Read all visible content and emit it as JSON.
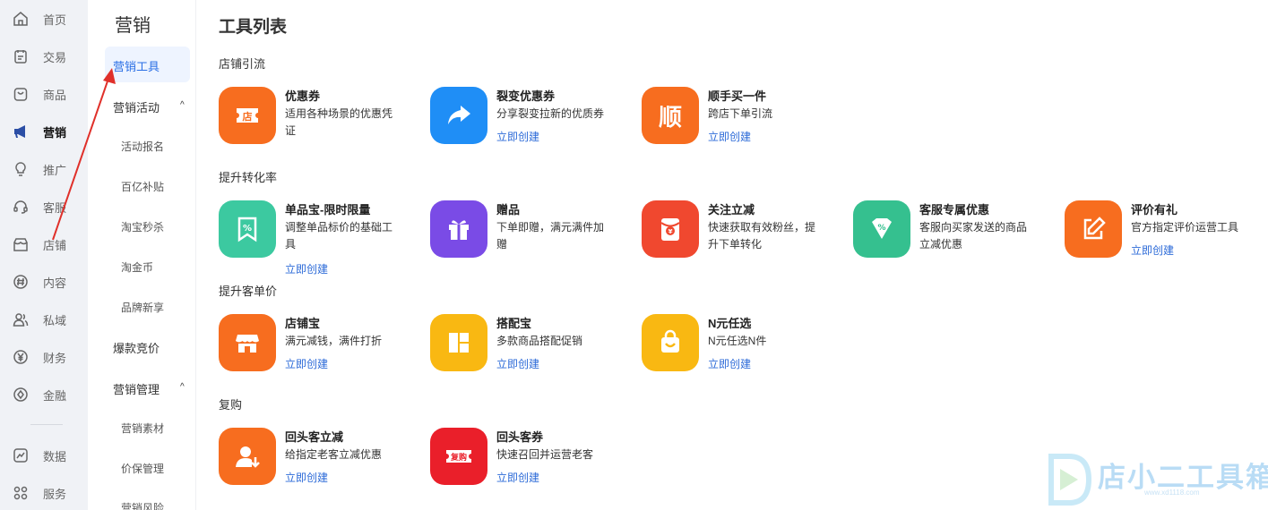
{
  "nav": {
    "items": [
      {
        "label": "首页",
        "icon": "home-icon"
      },
      {
        "label": "交易",
        "icon": "clipboard-icon"
      },
      {
        "label": "商品",
        "icon": "bag-icon"
      },
      {
        "label": "营销",
        "icon": "megaphone-icon",
        "active": true
      },
      {
        "label": "推广",
        "icon": "bulb-icon"
      },
      {
        "label": "客服",
        "icon": "headset-icon"
      },
      {
        "label": "店铺",
        "icon": "store-icon"
      },
      {
        "label": "内容",
        "icon": "hash-icon"
      },
      {
        "label": "私域",
        "icon": "people-icon"
      },
      {
        "label": "财务",
        "icon": "yen-icon"
      },
      {
        "label": "金融",
        "icon": "compass-icon"
      },
      {
        "label": "数据",
        "icon": "chart-icon"
      },
      {
        "label": "服务",
        "icon": "grid-icon"
      }
    ]
  },
  "submenu": {
    "title": "营销",
    "active_item": "营销工具",
    "group1": {
      "label": "营销活动",
      "children": [
        "活动报名",
        "百亿补贴",
        "淘宝秒杀",
        "淘金币",
        "品牌新享"
      ]
    },
    "standalone": "爆款竞价",
    "group2": {
      "label": "营销管理",
      "children": [
        "营销素材",
        "价保管理",
        "营销风险"
      ]
    },
    "caret": "^"
  },
  "main": {
    "title": "工具列表",
    "link_label": "立即创建",
    "sections": [
      {
        "title": "店铺引流",
        "tools": [
          {
            "name": "优惠券",
            "desc": "适用各种场景的优惠凭证",
            "link": "",
            "color": "#f76d1f",
            "icon": "store-ticket-icon",
            "glyph": "店"
          },
          {
            "name": "裂变优惠券",
            "desc": "分享裂变拉新的优质券",
            "link": "立即创建",
            "color": "#1f8ef6",
            "icon": "share-arrow-icon"
          },
          {
            "name": "顺手买一件",
            "desc": "跨店下单引流",
            "link": "立即创建",
            "color": "#f76d1f",
            "icon": "shun-glyph-icon",
            "glyph": "顺"
          }
        ]
      },
      {
        "title": "提升转化率",
        "tools": [
          {
            "name": "单品宝-限时限量",
            "desc": "调整单品标价的基础工具",
            "link": "立即创建",
            "color": "#3cc9a0",
            "icon": "percent-bookmark-icon"
          },
          {
            "name": "赠品",
            "desc": "下单即赠，满元满件加赠",
            "link": "",
            "color": "#7a4be6",
            "icon": "gift-icon"
          },
          {
            "name": "关注立减",
            "desc": "快速获取有效粉丝，提升下单转化",
            "link": "",
            "color": "#f0482f",
            "icon": "red-envelope-icon"
          },
          {
            "name": "客服专属优惠",
            "desc": "客服向买家发送的商品立减优惠",
            "link": "",
            "color": "#35c08f",
            "icon": "discount-tag-icon"
          },
          {
            "name": "评价有礼",
            "desc": "官方指定评价运营工具",
            "link": "立即创建",
            "color": "#f76d1f",
            "icon": "edit-icon"
          }
        ]
      },
      {
        "title": "提升客单价",
        "tools": [
          {
            "name": "店铺宝",
            "desc": "满元减钱，满件打折",
            "link": "立即创建",
            "color": "#f76d1f",
            "icon": "storefront-icon"
          },
          {
            "name": "搭配宝",
            "desc": "多款商品搭配促销",
            "link": "立即创建",
            "color": "#f9b812",
            "icon": "layout-icon"
          },
          {
            "name": "N元任选",
            "desc": "N元任选N件",
            "link": "立即创建",
            "color": "#f9b812",
            "icon": "shopping-bag-icon"
          }
        ]
      },
      {
        "title": "复购",
        "tools": [
          {
            "name": "回头客立减",
            "desc": "给指定老客立减优惠",
            "link": "立即创建",
            "color": "#f76d1f",
            "icon": "returning-user-icon"
          },
          {
            "name": "回头客券",
            "desc": "快速召回并运营老客",
            "link": "立即创建",
            "color": "#ea1f2a",
            "icon": "repurchase-ticket-icon",
            "glyph": "复购"
          }
        ]
      }
    ]
  },
  "watermark": {
    "text": "店小二工具箱",
    "url": "www.xd1118.com"
  }
}
